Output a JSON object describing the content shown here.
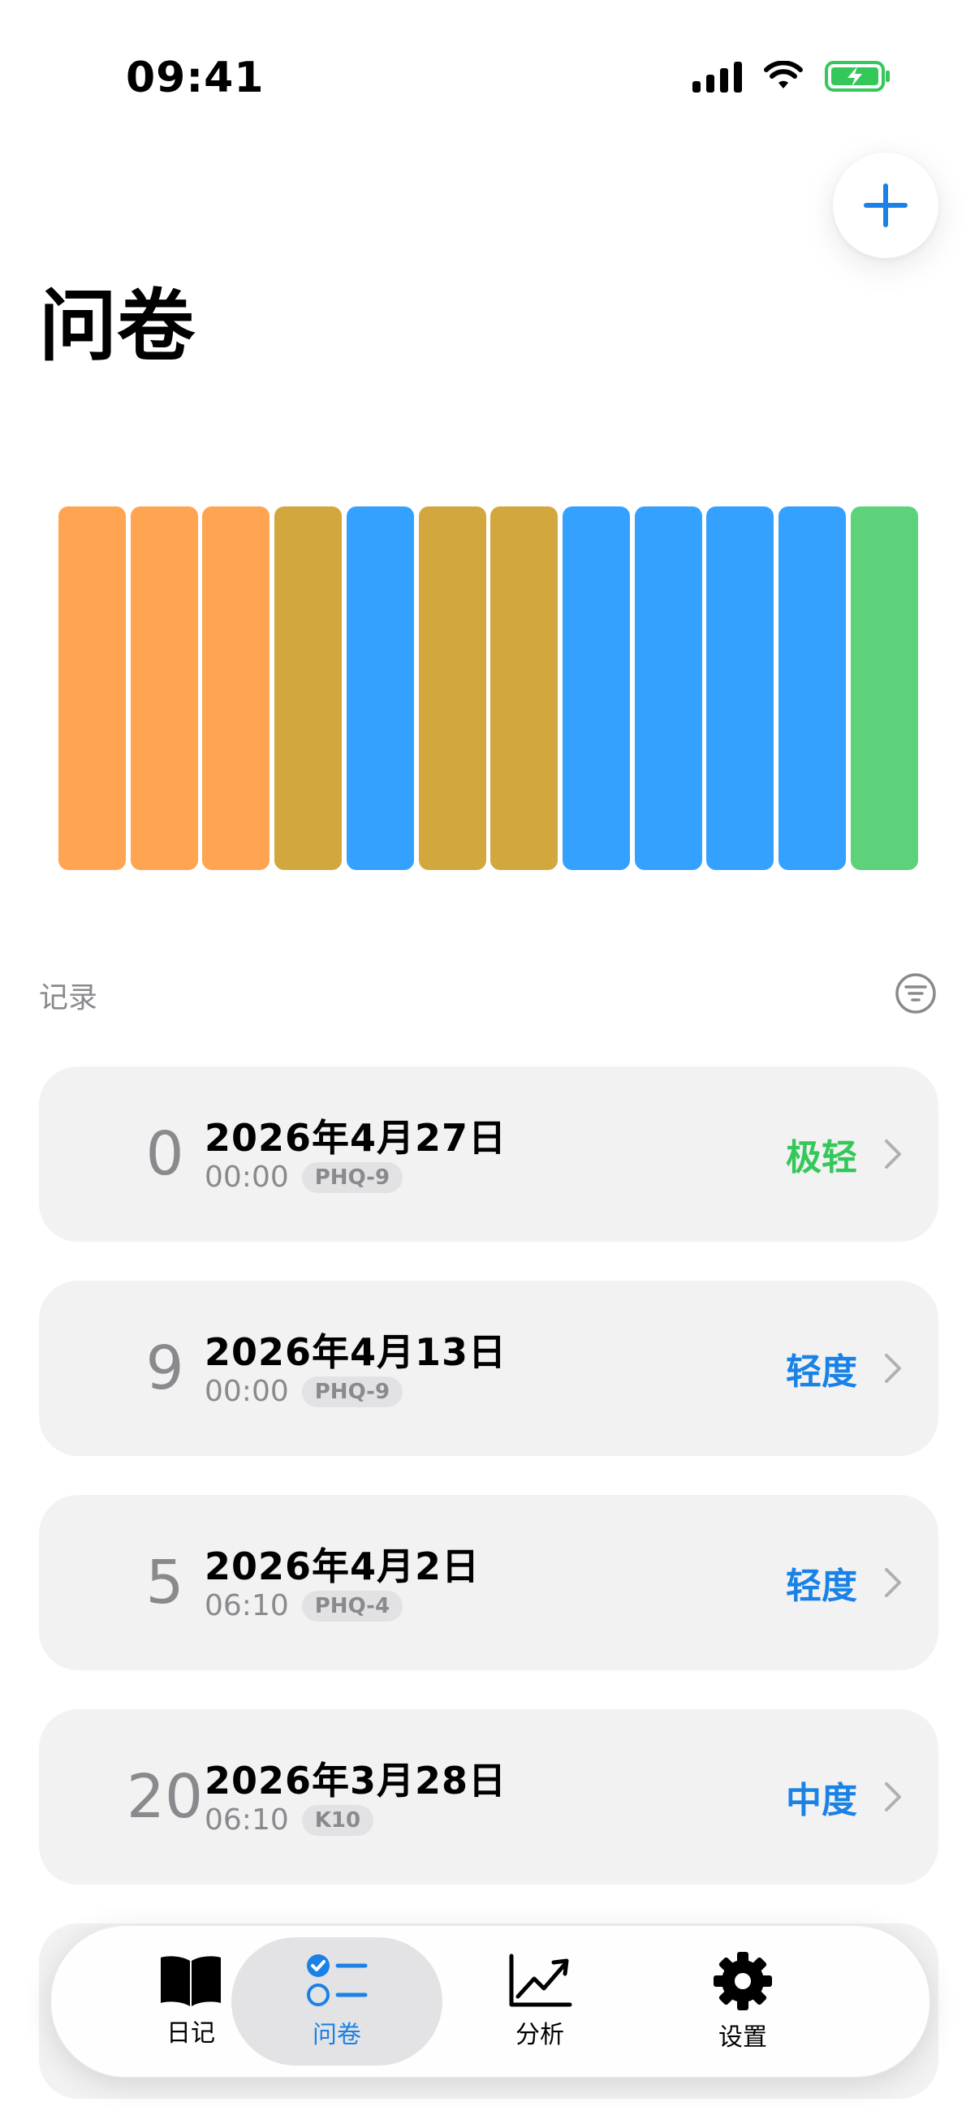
{
  "status_bar": {
    "time": "09:41"
  },
  "header": {
    "title": "问卷"
  },
  "bar_strip": {
    "colors": [
      "#FFA451",
      "#FFA451",
      "#FFA451",
      "#D2A73E",
      "#35A1FF",
      "#D2A73E",
      "#D2A73E",
      "#35A1FF",
      "#35A1FF",
      "#35A1FF",
      "#35A1FF",
      "#5DD27B"
    ]
  },
  "records_section": {
    "label": "记录"
  },
  "records": [
    {
      "score": "0",
      "date": "2026年4月27日",
      "time": "00:00",
      "tag": "PHQ-9",
      "level": "极轻",
      "level_color": "#34C759"
    },
    {
      "score": "9",
      "date": "2026年4月13日",
      "time": "00:00",
      "tag": "PHQ-9",
      "level": "轻度",
      "level_color": "#1A82E6"
    },
    {
      "score": "5",
      "date": "2026年4月2日",
      "time": "06:10",
      "tag": "PHQ-4",
      "level": "轻度",
      "level_color": "#1A82E6"
    },
    {
      "score": "20",
      "date": "2026年3月28日",
      "time": "06:10",
      "tag": "K10",
      "level": "中度",
      "level_color": "#1A82E6"
    }
  ],
  "tab_bar": {
    "tabs": [
      {
        "label": "日记",
        "icon": "book-icon",
        "active": false
      },
      {
        "label": "问卷",
        "icon": "checklist-icon",
        "active": true
      },
      {
        "label": "分析",
        "icon": "chart-icon",
        "active": false
      },
      {
        "label": "设置",
        "icon": "gear-icon",
        "active": false
      }
    ]
  },
  "colors": {
    "accent": "#1A82E6",
    "green": "#34C759",
    "card_background": "#F2F2F2"
  }
}
